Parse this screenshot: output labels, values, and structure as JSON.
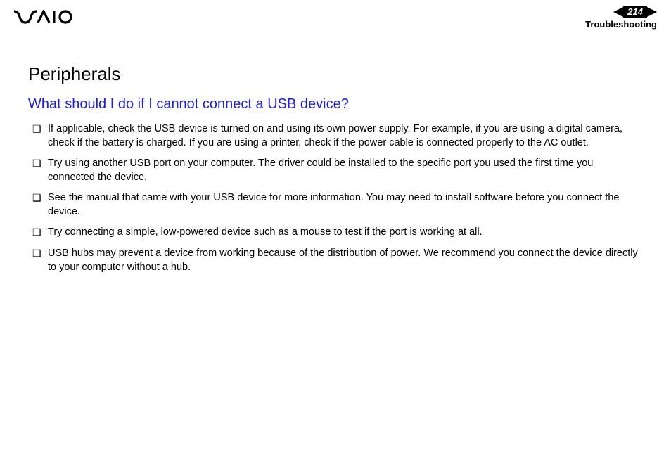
{
  "header": {
    "page_number": "214",
    "section": "Troubleshooting"
  },
  "content": {
    "title": "Peripherals",
    "subtitle": "What should I do if I cannot connect a USB device?",
    "bullets": [
      "If applicable, check the USB device is turned on and using its own power supply. For example, if you are using a digital camera, check if the battery is charged. If you are using a printer, check if the power cable is connected properly to the AC outlet.",
      "Try using another USB port on your computer. The driver could be installed to the specific port you used the first time you connected the device.",
      "See the manual that came with your USB device for more information. You may need to install software before you connect the device.",
      "Try connecting a simple, low-powered device such as a mouse to test if the port is working at all.",
      "USB hubs may prevent a device from working because of the distribution of power. We recommend you connect the device directly to your computer without a hub."
    ]
  }
}
